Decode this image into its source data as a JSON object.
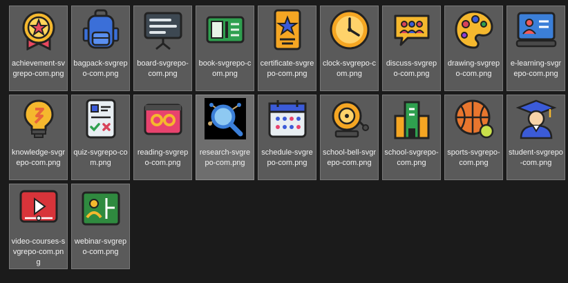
{
  "files": [
    {
      "name": "achievement-svgrepo-com.png",
      "icon": "achievement-icon"
    },
    {
      "name": "bagpack-svgrepo-com.png",
      "icon": "backpack-icon"
    },
    {
      "name": "board-svgrepo-com.png",
      "icon": "board-icon"
    },
    {
      "name": "book-svgrepo-com.png",
      "icon": "book-icon"
    },
    {
      "name": "certificate-svgrepo-com.png",
      "icon": "certificate-icon"
    },
    {
      "name": "clock-svgrepo-com.png",
      "icon": "clock-icon"
    },
    {
      "name": "discuss-svgrepo-com.png",
      "icon": "discuss-icon"
    },
    {
      "name": "drawing-svgrepo-com.png",
      "icon": "palette-icon"
    },
    {
      "name": "e-learning-svgrepo-com.png",
      "icon": "e-learning-icon"
    },
    {
      "name": "knowledge-svgrepo-com.png",
      "icon": "lightbulb-icon"
    },
    {
      "name": "quiz-svgrepo-com.png",
      "icon": "quiz-icon"
    },
    {
      "name": "reading-svgrepo-com.png",
      "icon": "reading-glasses-icon"
    },
    {
      "name": "research-svgrepo-com.png",
      "icon": "magnifier-icon"
    },
    {
      "name": "schedule-svgrepo-com.png",
      "icon": "calendar-icon"
    },
    {
      "name": "school-bell-svgrepo-com.png",
      "icon": "bell-icon"
    },
    {
      "name": "school-svgrepo-com.png",
      "icon": "school-building-icon"
    },
    {
      "name": "sports-svgrepo-com.png",
      "icon": "sports-balls-icon"
    },
    {
      "name": "student-svgrepo-com.png",
      "icon": "graduate-icon"
    },
    {
      "name": "video-courses-svgrepo-com.png",
      "icon": "video-play-icon"
    },
    {
      "name": "webinar-svgrepo-com.png",
      "icon": "webinar-icon"
    }
  ],
  "selected_file": "research-svgrepo-com.png",
  "colors": {
    "background": "#1b1b1b",
    "tile": "#5a5a5a",
    "tile_border": "#7a7a7a",
    "selected_tile": "#6e6e6e",
    "label": "#f2f2f2"
  }
}
